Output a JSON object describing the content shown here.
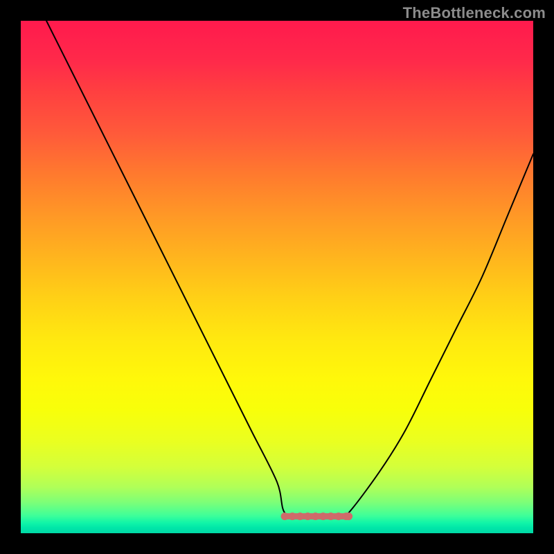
{
  "watermark": "TheBottleneck.com",
  "chart_data": {
    "type": "line",
    "title": "",
    "xlabel": "",
    "ylabel": "",
    "xlim": [
      0,
      100
    ],
    "ylim": [
      0,
      100
    ],
    "series": [
      {
        "name": "curve",
        "x": [
          5,
          10,
          15,
          20,
          25,
          30,
          35,
          40,
          45,
          50,
          51.5,
          55,
          58,
          62,
          64,
          70,
          75,
          80,
          85,
          90,
          95,
          100
        ],
        "values": [
          100,
          90,
          80,
          70,
          60,
          50,
          40,
          30,
          20,
          10,
          4,
          3,
          3,
          3,
          4,
          12,
          20,
          30,
          40,
          50,
          62,
          74
        ]
      }
    ],
    "flat_region": {
      "x_start": 51.5,
      "x_end": 64,
      "y": 3.3
    },
    "flat_dots_x": [
      51.5,
      53,
      54.5,
      56,
      57.5,
      59,
      60.5,
      62,
      63.5,
      64
    ],
    "background_gradient": {
      "top": "#ff1a4d",
      "mid": "#ffe810",
      "bottom": "#00d8a6"
    }
  }
}
